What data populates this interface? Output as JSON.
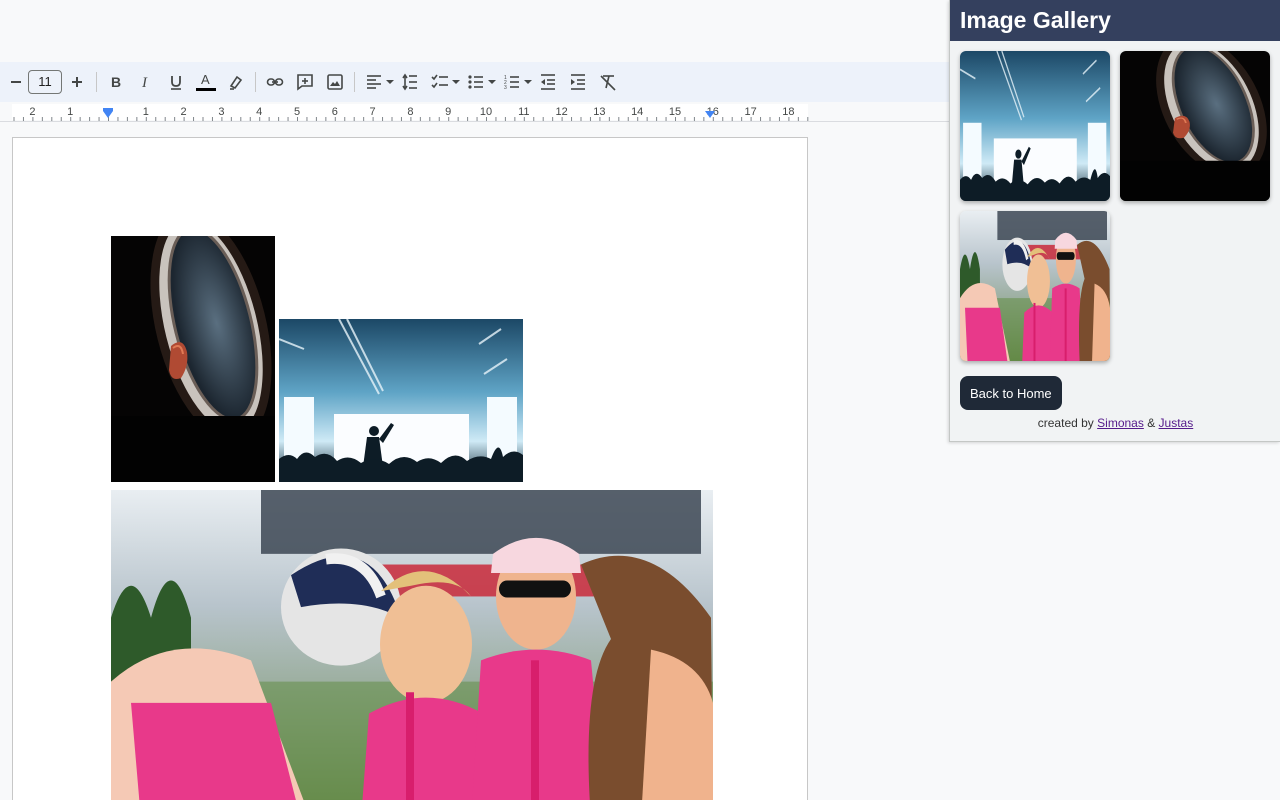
{
  "toolbar": {
    "font_size": "11"
  },
  "ruler": {
    "labels": [
      "2",
      "1",
      "1",
      "2",
      "3",
      "4",
      "5",
      "6",
      "7",
      "8",
      "9",
      "10",
      "11",
      "12",
      "13",
      "14",
      "15",
      "16",
      "17",
      "18"
    ]
  },
  "gallery": {
    "title": "Image Gallery",
    "back_label": "Back to Home",
    "credit_prefix": "created by",
    "credit_author1": "Simonas",
    "credit_amp": "&",
    "credit_author2": "Justas",
    "thumbnails": [
      "concert-photo",
      "airplane-window-photo",
      "pink-walkers-photo"
    ]
  },
  "document": {
    "images": [
      "airplane-window-photo",
      "concert-photo",
      "pink-walkers-photo"
    ]
  },
  "colors": {
    "gallery_header": "#34405e",
    "button": "#1f2937",
    "toolbar_bg": "#edf2fa",
    "link": "#551a8b",
    "accent_pink": "#e8398a"
  }
}
